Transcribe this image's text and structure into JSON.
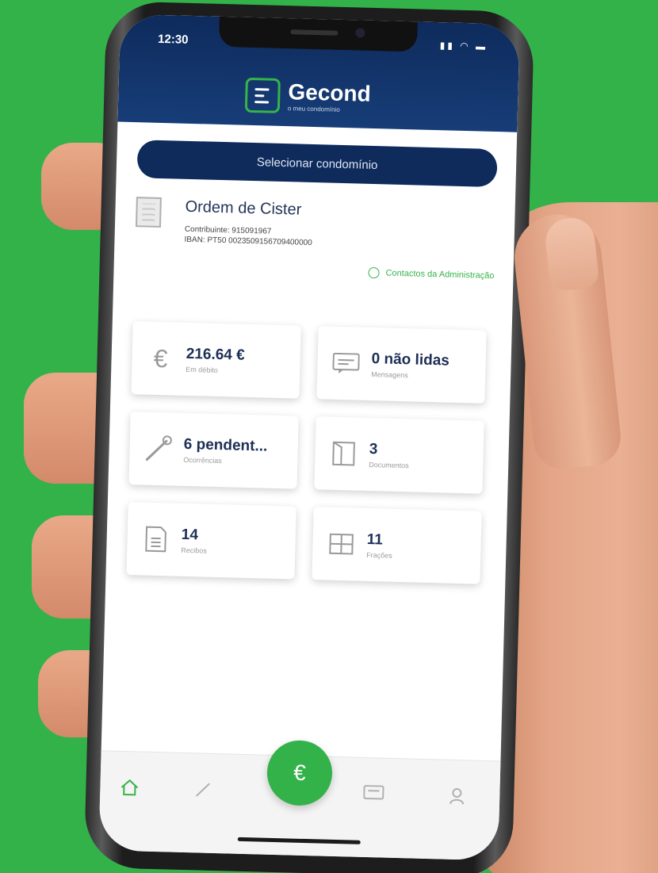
{
  "status": {
    "time": "12:30"
  },
  "header": {
    "app_name": "Gecond",
    "app_subtitle": "o meu condomínio"
  },
  "select_button": "Selecionar condomínio",
  "condominium": {
    "name": "Ordem de Cister",
    "taxpayer": "Contribuinte: 915091967",
    "iban": "IBAN: PT50 0023509156709400000"
  },
  "contact_link": "Contactos da Administração",
  "cards": [
    {
      "icon": "euro-icon",
      "value": "216.64 €",
      "label": "Em débito"
    },
    {
      "icon": "message-icon",
      "value": "0 não lidas",
      "label": "Mensagens"
    },
    {
      "icon": "wrench-icon",
      "value": "6 pendent...",
      "label": "Ocorrências"
    },
    {
      "icon": "folder-icon",
      "value": "3",
      "label": "Documentos"
    },
    {
      "icon": "receipt-icon",
      "value": "14",
      "label": "Recibos"
    },
    {
      "icon": "fraction-icon",
      "value": "11",
      "label": "Frações"
    }
  ],
  "tabbar": {
    "home": "home-icon",
    "occurrences": "wrench-icon",
    "payments": "€",
    "messages": "message-icon",
    "profile": "user-icon"
  },
  "colors": {
    "brand_green": "#33b24a",
    "brand_navy": "#0e2b5c"
  }
}
